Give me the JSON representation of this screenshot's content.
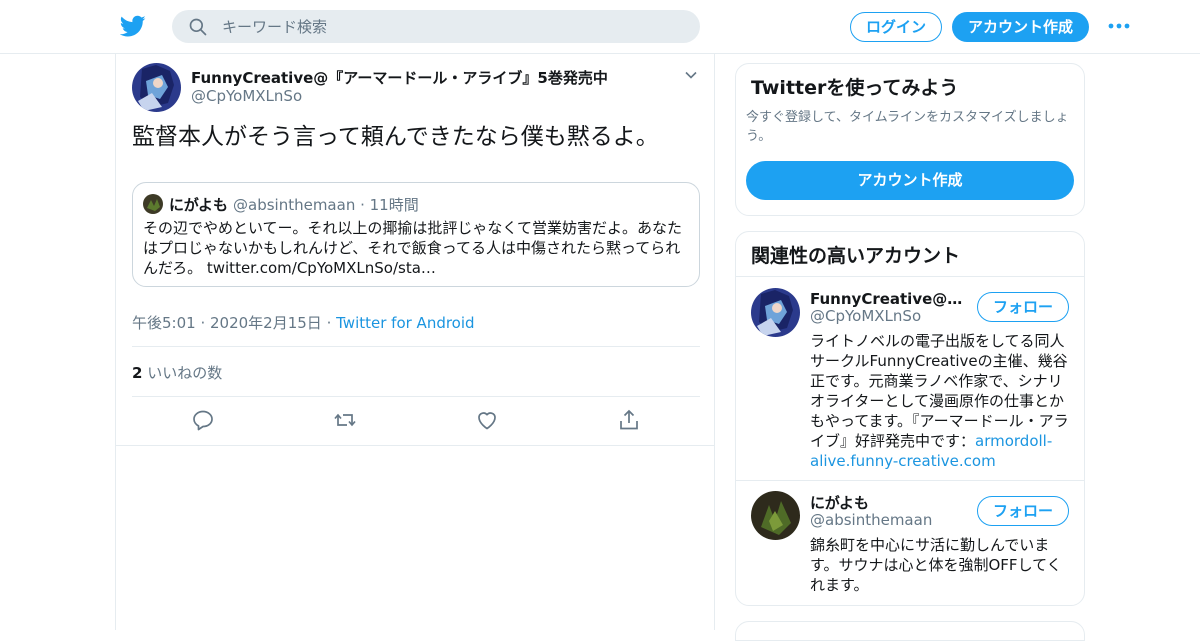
{
  "header": {
    "search_placeholder": "キーワード検索",
    "login_label": "ログイン",
    "signup_label": "アカウント作成"
  },
  "tweet": {
    "author_name": "FunnyCreative@『アーマードール・アライブ』5巻発売中",
    "author_handle": "@CpYoMXLnSo",
    "text": "監督本人がそう言って頼んできたなら僕も黙るよ。",
    "quote": {
      "name": "にがよも",
      "handle": "@absinthemaan · 11時間",
      "text": "その辺でやめといてー。それ以上の揶揄は批評じゃなくて営業妨害だよ。あなたはプロじゃないかもしれんけど、それで飯食ってる人は中傷されたら黙ってられんだろ。 twitter.com/CpYoMXLnSo/sta…"
    },
    "timestamp": "午後5:01 · 2020年2月15日",
    "source": "Twitter for Android",
    "likes_count": "2",
    "likes_label": "いいねの数"
  },
  "sidebar": {
    "try_card": {
      "title": "Twitterを使ってみよう",
      "desc": "今すぐ登録して、タイムラインをカスタマイズしましょう。",
      "signup_label": "アカウント作成"
    },
    "relevant": {
      "title": "関連性の高いアカウント",
      "accounts": [
        {
          "name": "FunnyCreative@『…",
          "handle": "@CpYoMXLnSo",
          "follow_label": "フォロー",
          "bio": "ライトノベルの電子出版をしてる同人サークルFunnyCreativeの主催、幾谷正です。元商業ラノベ作家で、シナリオライターとして漫画原作の仕事とかもやってます。『アーマードール・アライブ』好評発売中です：",
          "bio_link": "armordoll-alive.funny-creative.com"
        },
        {
          "name": "にがよも",
          "handle": "@absinthemaan",
          "follow_label": "フォロー",
          "bio": "錦糸町を中心にサ活に勤しんでいます。サウナは心と体を強制OFFしてくれます。"
        }
      ]
    }
  },
  "colors": {
    "accent": "#1da1f2",
    "link": "#1b95e0",
    "secondary_text": "#657786",
    "border": "#e6ecf0"
  },
  "icons": [
    "twitter-bird-icon",
    "search-icon",
    "more-dots-icon",
    "caret-down-icon",
    "reply-icon",
    "retweet-icon",
    "like-icon",
    "share-icon"
  ]
}
